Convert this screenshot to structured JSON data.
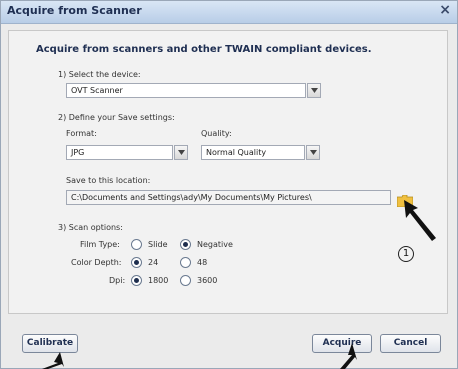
{
  "window": {
    "title": "Acquire from Scanner",
    "close_glyph": "×"
  },
  "heading": "Acquire from scanners and other TWAIN compliant devices.",
  "device": {
    "section_label": "1) Select the device:",
    "value": "OVT Scanner"
  },
  "save_settings": {
    "section_label": "2) Define your Save settings:",
    "format_label": "Format:",
    "format_value": "JPG",
    "quality_label": "Quality:",
    "quality_value": "Normal Quality",
    "location_label": "Save to this location:",
    "location_value": "C:\\Documents and Settings\\ady\\My Documents\\My Pictures\\",
    "browse_icon": "folder-icon"
  },
  "scan_options": {
    "section_label": "3) Scan options:",
    "film_type": {
      "label": "Film Type:",
      "options": [
        "Slide",
        "Negative"
      ],
      "selected": "Negative"
    },
    "color_depth": {
      "label": "Color Depth:",
      "options": [
        "24",
        "48"
      ],
      "selected": "24"
    },
    "dpi": {
      "label": "Dpi:",
      "options": [
        "1800",
        "3600"
      ],
      "selected": "1800"
    }
  },
  "annotation_number": "1",
  "buttons": {
    "calibrate": "Calibrate",
    "acquire": "Acquire",
    "cancel": "Cancel"
  },
  "colors": {
    "title_text": "#1f2f52",
    "window_bg": "#ebebeb",
    "folder": "#f0c040"
  }
}
